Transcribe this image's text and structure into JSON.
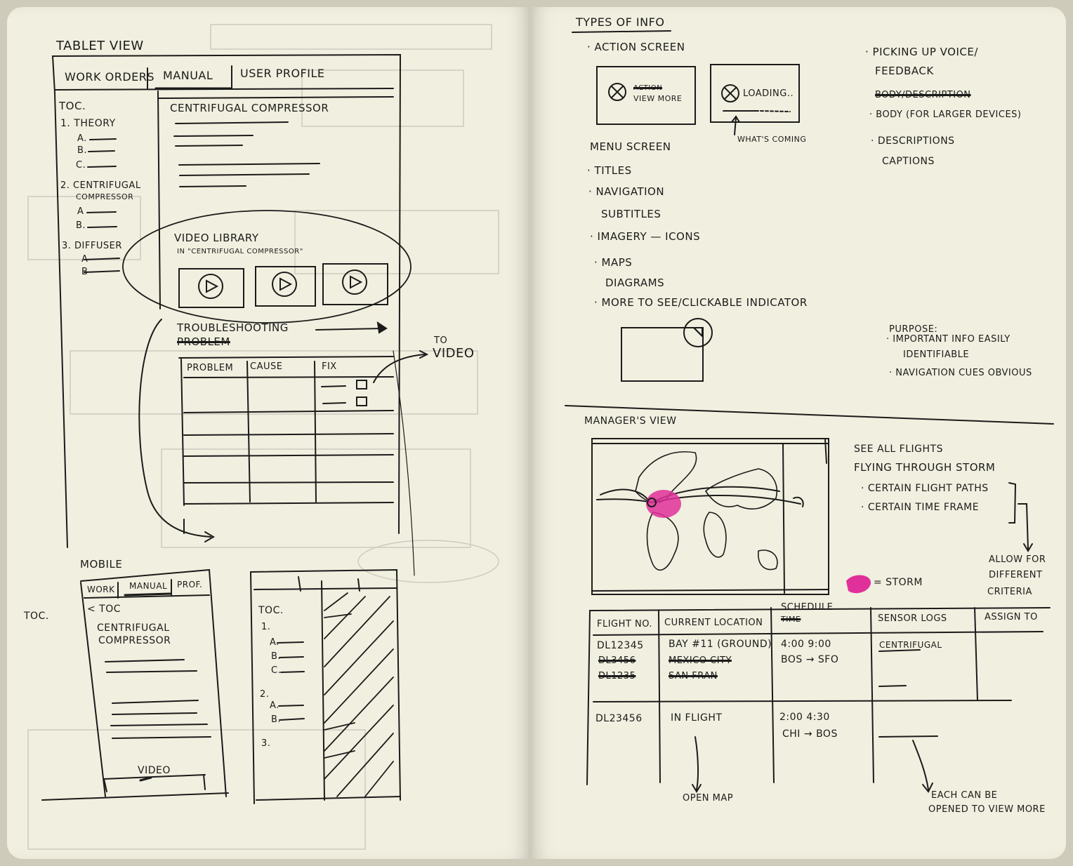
{
  "left": {
    "tablet": {
      "title": "TABLET VIEW",
      "tabs": [
        "WORK ORDERS",
        "MANUAL",
        "USER PROFILE"
      ],
      "toc_title": "TOC.",
      "toc_items": [
        "1. THEORY",
        "a.",
        "b.",
        "c.",
        "2. CENTRIFUGAL",
        "COMPRESSOR",
        "a",
        "b.",
        "3. DIFFUSER",
        "a",
        "b"
      ],
      "content_title": "CENTRIFUGAL COMPRESSOR",
      "video_library": "VIDEO LIBRARY",
      "video_library_sub": "IN \"CENTRIFUGAL COMPRESSOR\"",
      "troubleshooting": "TROUBLESHOOTING",
      "troubleshooting_struck": "PROBLEM",
      "table_headers": [
        "PROBLEM",
        "CAUSE",
        "FIX"
      ],
      "to_video": [
        "TO",
        "VIDEO"
      ]
    },
    "mobile": {
      "title": "MOBILE",
      "tabs": [
        "WORK",
        "MANUAL",
        "PROF."
      ],
      "toc_outside": "TOC.",
      "back_toc": "< TOC",
      "content_title": [
        "CENTRIFUGAL",
        "COMPRESSOR"
      ],
      "video": "VIDEO",
      "toc_title": "TOC.",
      "toc_items": [
        "1.",
        "a.",
        "b.",
        "c.",
        "2.",
        "a.",
        "b.",
        "3."
      ]
    }
  },
  "right": {
    "types_title": "TYPES OF INFO",
    "types": [
      "· ACTION SCREEN",
      "MENU SCREEN",
      "· TITLES",
      "· NAVIGATION",
      "SUBTITLES",
      "· IMAGERY — ICONS",
      "· MAPS",
      "DIAGRAMS",
      "· MORE TO SEE/CLICKABLE INDICATOR"
    ],
    "action_box1": {
      "struck": "ACTION",
      "label": "VIEW MORE"
    },
    "action_box2": {
      "label": "LOADING..",
      "note": "WHAT'S COMING"
    },
    "voice": [
      "· PICKING UP VOICE/",
      "FEEDBACK",
      "BODY/DESCRIPTION",
      "· BODY (FOR LARGER DEVICES)",
      "· DESCRIPTIONS",
      "CAPTIONS"
    ],
    "purpose": [
      "PURPOSE:",
      "· IMPORTANT INFO EASILY",
      "IDENTIFIABLE",
      "· NAVIGATION CUES OBVIOUS"
    ],
    "manager_title": "MANAGER'S VIEW",
    "manager_notes": [
      "SEE ALL FLIGHTS",
      "FLYING THROUGH STORM",
      "· CERTAIN FLIGHT PATHS",
      "· CERTAIN TIME FRAME"
    ],
    "allow": [
      "ALLOW FOR",
      "DIFFERENT",
      "CRITERIA"
    ],
    "storm_legend": "= STORM",
    "storm_color": "#e0309a",
    "table": {
      "headers": [
        "FLIGHT NO.",
        "CURRENT LOCATION",
        "SCHEDULE",
        "SENSOR LOGS",
        "ASSIGN TO"
      ],
      "header_struck": "TIME",
      "rows": [
        {
          "flight": "DL12345",
          "location": "BAY #11 (GROUND)",
          "schedule": [
            "4:00  9:00",
            "BOS → SFO"
          ],
          "sensor": "CENTRIFUGAL"
        },
        {
          "flight": "DL3456",
          "location": "MEXICO CITY",
          "struck": true
        },
        {
          "flight": "DL1235",
          "location": "SAN FRAN",
          "struck": true
        },
        {
          "flight": "DL23456",
          "location": "IN FLIGHT",
          "schedule": [
            "2:00  4:30",
            "CHI → BOS"
          ]
        }
      ]
    },
    "open_map": "OPEN MAP",
    "each_can_be": [
      "EACH CAN BE",
      "OPENED TO VIEW MORE"
    ]
  },
  "ink_color": "#1b1b1b"
}
